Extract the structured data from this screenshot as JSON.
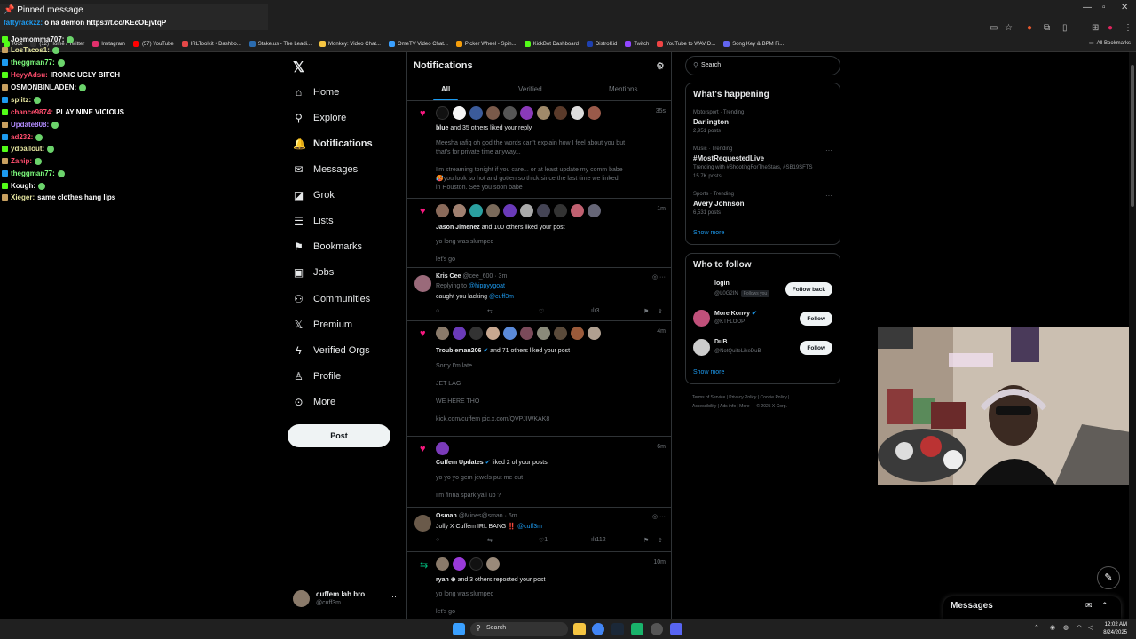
{
  "bookmarks": [
    {
      "label": "Kick",
      "color": "#53fc18"
    },
    {
      "label": "(12) Home / Twitter",
      "color": "#333333"
    },
    {
      "label": "Instagram",
      "color": "#e1306c"
    },
    {
      "label": "(57) YouTube",
      "color": "#ff0000"
    },
    {
      "label": "IRLToolkit • Dashbo...",
      "color": "#e54848"
    },
    {
      "label": "Stake.us - The Leadi...",
      "color": "#2b6cb0"
    },
    {
      "label": "Monkey: Video Chat...",
      "color": "#f5c542"
    },
    {
      "label": "OmeTV Video Chat...",
      "color": "#3aa0ff"
    },
    {
      "label": "Picker Wheel - Spin...",
      "color": "#f59e0b"
    },
    {
      "label": "KickBot Dashboard",
      "color": "#53fc18"
    },
    {
      "label": "DistroKid",
      "color": "#1e40af"
    },
    {
      "label": "Twitch",
      "color": "#9146ff"
    },
    {
      "label": "YouTube to WAV D...",
      "color": "#ef4444"
    },
    {
      "label": "Song Key & BPM Fi...",
      "color": "#6366f1"
    }
  ],
  "bookmarks_all": "All Bookmarks",
  "chat": {
    "pinned_title": "Pinned message",
    "pinned_user": "fattyrackzz:",
    "pinned_text": "o na demon https://t.co/KEcOEjvtqP",
    "lines": [
      {
        "user": "Joemomma707:",
        "color": "#f2f2f2",
        "text": ""
      },
      {
        "user": "LosTacos1:",
        "color": "#e6e6a0",
        "text": ""
      },
      {
        "user": "theggman77:",
        "color": "#7fff7f",
        "text": ""
      },
      {
        "user": "HeyyAdsu:",
        "color": "#ff4d6d",
        "text": "IRONIC UGLY BITCH"
      },
      {
        "user": "OSMONBINLADEN:",
        "color": "#f2f2f2",
        "text": ""
      },
      {
        "user": "splitz:",
        "color": "#e6e6a0",
        "text": ""
      },
      {
        "user": "chance9874:",
        "color": "#ff4d6d",
        "text": "PLAY NINE VICIOUS"
      },
      {
        "user": "Update808:",
        "color": "#b38cff",
        "text": ""
      },
      {
        "user": "ad232:",
        "color": "#ff4d6d",
        "text": ""
      },
      {
        "user": "ydballout:",
        "color": "#e6e6a0",
        "text": ""
      },
      {
        "user": "Zanip:",
        "color": "#ff4d6d",
        "text": ""
      },
      {
        "user": "theggman77:",
        "color": "#7fff7f",
        "text": ""
      },
      {
        "user": "Kough:",
        "color": "#f2f2f2",
        "text": ""
      },
      {
        "user": "Xieger:",
        "color": "#e6e6a0",
        "text": "same clothes hang lips"
      }
    ]
  },
  "nav": {
    "items": [
      {
        "label": "Home",
        "icon": "⌂",
        "name": "home"
      },
      {
        "label": "Explore",
        "icon": "⚲",
        "name": "explore"
      },
      {
        "label": "Notifications",
        "icon": "🔔",
        "name": "notifications"
      },
      {
        "label": "Messages",
        "icon": "✉",
        "name": "messages"
      },
      {
        "label": "Grok",
        "icon": "◪",
        "name": "grok"
      },
      {
        "label": "Lists",
        "icon": "☰",
        "name": "lists"
      },
      {
        "label": "Bookmarks",
        "icon": "⚑",
        "name": "bookmarks"
      },
      {
        "label": "Jobs",
        "icon": "▣",
        "name": "jobs"
      },
      {
        "label": "Communities",
        "icon": "⚇",
        "name": "communities"
      },
      {
        "label": "Premium",
        "icon": "𝕏",
        "name": "premium"
      },
      {
        "label": "Verified Orgs",
        "icon": "ϟ",
        "name": "verified-orgs"
      },
      {
        "label": "Profile",
        "icon": "♙",
        "name": "profile"
      },
      {
        "label": "More",
        "icon": "⊙",
        "name": "more"
      }
    ],
    "post_label": "Post",
    "account_name": "cuffem lah bro",
    "account_handle": "@cuff3m"
  },
  "notifications": {
    "title": "Notifications",
    "tabs": [
      "All",
      "Verified",
      "Mentions"
    ],
    "n1": {
      "time": "35s",
      "actor": "blue",
      "action": "and 35 others liked your reply",
      "text1": "Meesha rafiq oh god the words can't explain how I feel about you but",
      "text2": "that's for private time anyway...",
      "text3": "I'm streaming tonight if you care... or at least update my comm babe",
      "text4": "🥵you look so hot and gotten so thick since the last time we linked",
      "text5": "in Houston. See you soon babe"
    },
    "n2": {
      "time": "1m",
      "actor": "Jason Jimenez",
      "action": "and 100 others liked your post",
      "text1": "yo long was slumped",
      "text2": "let's go"
    },
    "r1": {
      "name": "Kris Cee",
      "meta": "@cee_600 · 3m",
      "replying": "Replying to",
      "replying_to": "@hippyygoat",
      "text": "caught you lacking",
      "mention": "@cuff3m",
      "views": "3"
    },
    "n3": {
      "time": "4m",
      "actor": "Troubleman206",
      "action": "and 71 others liked your post",
      "text1": "Sorry I'm late",
      "text2": "JET LAG",
      "text3": "WE HERE THO",
      "text4": "kick.com/cuffem pic.x.com/QVPJIWKAK8"
    },
    "n4": {
      "time": "6m",
      "actor": "Cuffem Updates",
      "action": "liked 2 of your posts",
      "text1": "yo yo yo gem jewels put me out",
      "text2": "I'm finna spark yall up ?"
    },
    "r2": {
      "name": "Osman",
      "meta": "@Mines@sman · 6m",
      "text": "Jolly X Cuffem IRL BANG ‼️",
      "mention": "@cuff3m",
      "likes": "1",
      "views": "112"
    },
    "n5": {
      "time": "10m",
      "actor": "ryan ⊕",
      "action": "and 3 others reposted your post",
      "text1": "yo long was slumped",
      "text2": "let's go"
    }
  },
  "right": {
    "search_placeholder": "Search",
    "happening_title": "What's happening",
    "trends": [
      {
        "cat": "Motorsport · Trending",
        "name": "Darlington",
        "posts": "2,951 posts",
        "extra": ""
      },
      {
        "cat": "Music · Trending",
        "name": "#MostRequestedLive",
        "posts": "15.7K posts",
        "extra": "Trending with #ShootingForTheStars, #SB19SFTS"
      },
      {
        "cat": "Sports · Trending",
        "name": "Avery Johnson",
        "posts": "6,531 posts",
        "extra": ""
      }
    ],
    "show_more": "Show more",
    "wtf_title": "Who to follow",
    "follows": [
      {
        "name": "login",
        "handle": "@L0G2IN",
        "follows_you": "Follows you",
        "btn": "Follow back"
      },
      {
        "name": "More Konvy",
        "handle": "@KTFLOOP",
        "follows_you": "",
        "btn": "Follow"
      },
      {
        "name": "DuB",
        "handle": "@NotQuiteLikeDuB",
        "follows_you": "",
        "btn": "Follow"
      }
    ],
    "footer1": "Terms of Service  |  Privacy Policy  |  Cookie Policy  |",
    "footer2": "Accessibility  |  Ads info  |  More ···  © 2025 X Corp."
  },
  "messages_drawer": "Messages",
  "taskbar": {
    "search": "Search",
    "time": "12:02 AM",
    "date": "8/24/2025"
  },
  "colors": {
    "accent": "#1d9bf0",
    "like": "#f91880",
    "repost": "#00ba7c"
  }
}
